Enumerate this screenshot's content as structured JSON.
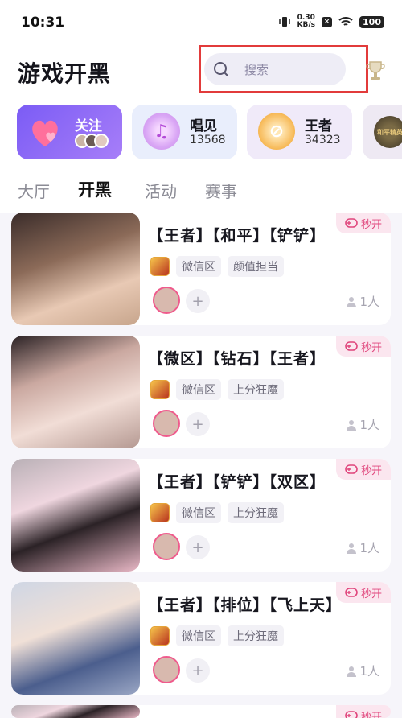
{
  "status_bar": {
    "time": "10:31",
    "net_speed_value": "0.30",
    "net_speed_unit": "KB/s",
    "battery": "100"
  },
  "header": {
    "title": "游戏开黑",
    "search_placeholder": "搜索"
  },
  "categories": [
    {
      "label": "关注"
    },
    {
      "label": "唱见",
      "count": "13568"
    },
    {
      "label": "王者",
      "count": "34323"
    },
    {
      "label": "和平精英"
    }
  ],
  "tabs": [
    "大厅",
    "开黑",
    "活动",
    "赛事"
  ],
  "active_tab": "开黑",
  "rooms": [
    {
      "title": "【王者】【和平】【铲铲】",
      "badge": "秒开",
      "tags": [
        "微信区",
        "颜值担当"
      ],
      "people": "1人"
    },
    {
      "title": "【微区】【钻石】【王者】",
      "badge": "秒开",
      "tags": [
        "微信区",
        "上分狂魔"
      ],
      "people": "1人"
    },
    {
      "title": "【王者】【铲铲】【双区】",
      "badge": "秒开",
      "tags": [
        "微信区",
        "上分狂魔"
      ],
      "people": "1人"
    },
    {
      "title": "【王者】【排位】【飞上天】",
      "badge": "秒开",
      "tags": [
        "微信区",
        "上分狂魔"
      ],
      "people": "1人"
    },
    {
      "badge": "秒开"
    }
  ],
  "colors": {
    "accent_purple": "#7b5cf5",
    "badge_pink": "#e0457c",
    "highlight_frame": "#e23b3b"
  }
}
